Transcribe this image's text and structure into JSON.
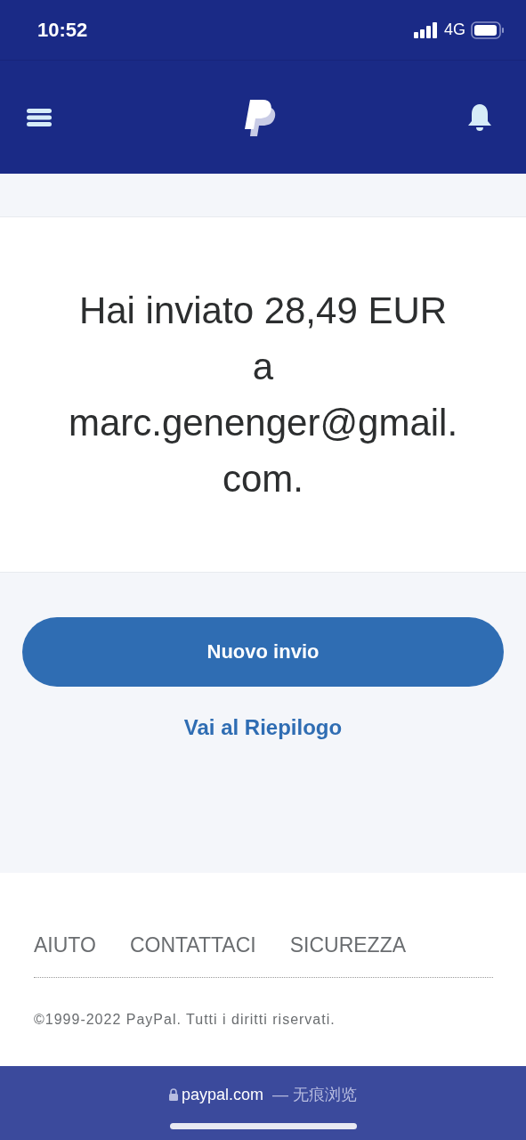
{
  "status_bar": {
    "time": "10:52",
    "network": "4G"
  },
  "message": "Hai inviato 28,49 EUR a marc.genenger@gmail.com.",
  "primary_button": "Nuovo invio",
  "secondary_link": "Vai al Riepilogo",
  "footer": {
    "links": [
      "AIUTO",
      "CONTATTACI",
      "SICUREZZA"
    ],
    "copyright": "©1999-2022 PayPal. Tutti i diritti riservati."
  },
  "browser_bar": {
    "domain": "paypal.com",
    "mode": "— 无痕浏览"
  }
}
